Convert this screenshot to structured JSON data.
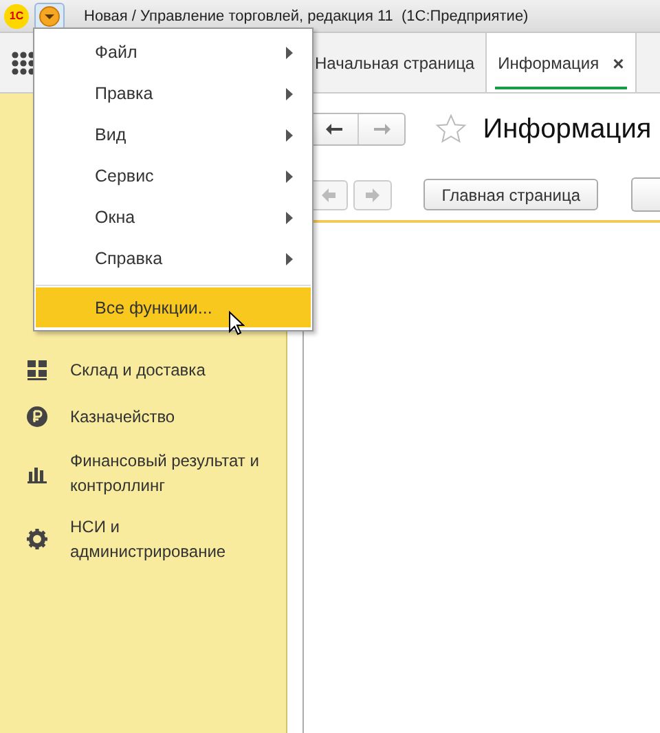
{
  "title_bar": {
    "logo": "1С",
    "menu_button_pressed": true,
    "title": "Новая / Управление торговлей, редакция 11  (1С:Предприятие)"
  },
  "tabs": [
    {
      "label": "Начальная страница",
      "selected": false
    },
    {
      "label": "Информация",
      "selected": true,
      "close": "×"
    }
  ],
  "sidebar": {
    "items": [
      {
        "label": "Склад и доставка"
      },
      {
        "label": "Казначейство"
      },
      {
        "label": "Финансовый результат и контроллинг"
      },
      {
        "label": "НСИ и администрирование"
      }
    ]
  },
  "page": {
    "title": "Информация",
    "favorite": false,
    "buttons": [
      "Главная страница"
    ]
  },
  "main_menu": {
    "items": [
      {
        "label": "Файл",
        "submenu": true,
        "selected": false
      },
      {
        "label": "Правка",
        "submenu": true,
        "selected": false
      },
      {
        "label": "Вид",
        "submenu": true,
        "selected": false
      },
      {
        "label": "Сервис",
        "submenu": true,
        "selected": false
      },
      {
        "label": "Окна",
        "submenu": true,
        "selected": false
      },
      {
        "label": "Справка",
        "submenu": true,
        "selected": false
      },
      {
        "label": "Все функции...",
        "submenu": false,
        "selected": true,
        "separator_before": true
      }
    ]
  }
}
